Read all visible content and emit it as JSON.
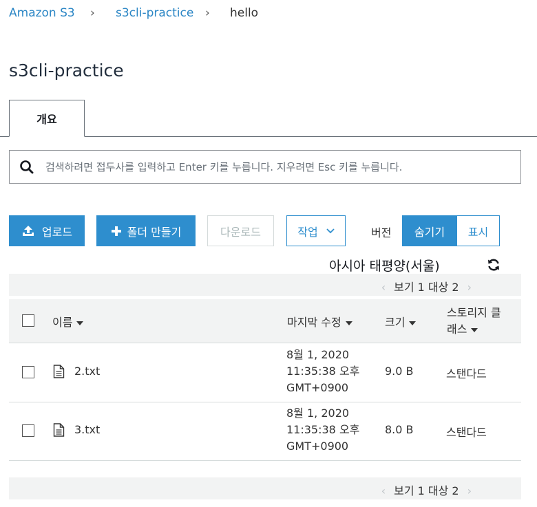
{
  "breadcrumb": {
    "root": "Amazon S3",
    "bucket": "s3cli-practice",
    "current": "hello",
    "separator": "›"
  },
  "page_title": "s3cli-practice",
  "tabs": [
    {
      "label": "개요"
    }
  ],
  "search": {
    "placeholder": "검색하려면 접두사를 입력하고 Enter 키를 누릅니다. 지우려면 Esc 키를 누릅니다."
  },
  "toolbar": {
    "upload_label": "업로드",
    "new_folder_label": "폴더 만들기",
    "download_label": "다운로드",
    "actions_label": "작업",
    "versions_label": "버전",
    "hide_label": "숨기기",
    "show_label": "표시"
  },
  "region": "아시아 태평양(서울)",
  "pagination": {
    "text": "보기 1 대상 2"
  },
  "table": {
    "columns": {
      "name": "이름",
      "modified_line1": "마지막 수정",
      "size": "크기",
      "storage_line1": "스토리지 클",
      "storage_line2": "래스"
    },
    "rows": [
      {
        "name": "2.txt",
        "modified_date": "8월 1, 2020",
        "modified_time": "11:35:38 오후",
        "modified_tz": "GMT+0900",
        "size": "9.0 B",
        "storage_class": "스탠다드"
      },
      {
        "name": "3.txt",
        "modified_date": "8월 1, 2020",
        "modified_time": "11:35:38 오후",
        "modified_tz": "GMT+0900",
        "size": "8.0 B",
        "storage_class": "스탠다드"
      }
    ]
  },
  "colors": {
    "link": "#2b86c5",
    "primary": "#2e8ece",
    "header_bg": "#f2f3f3"
  }
}
